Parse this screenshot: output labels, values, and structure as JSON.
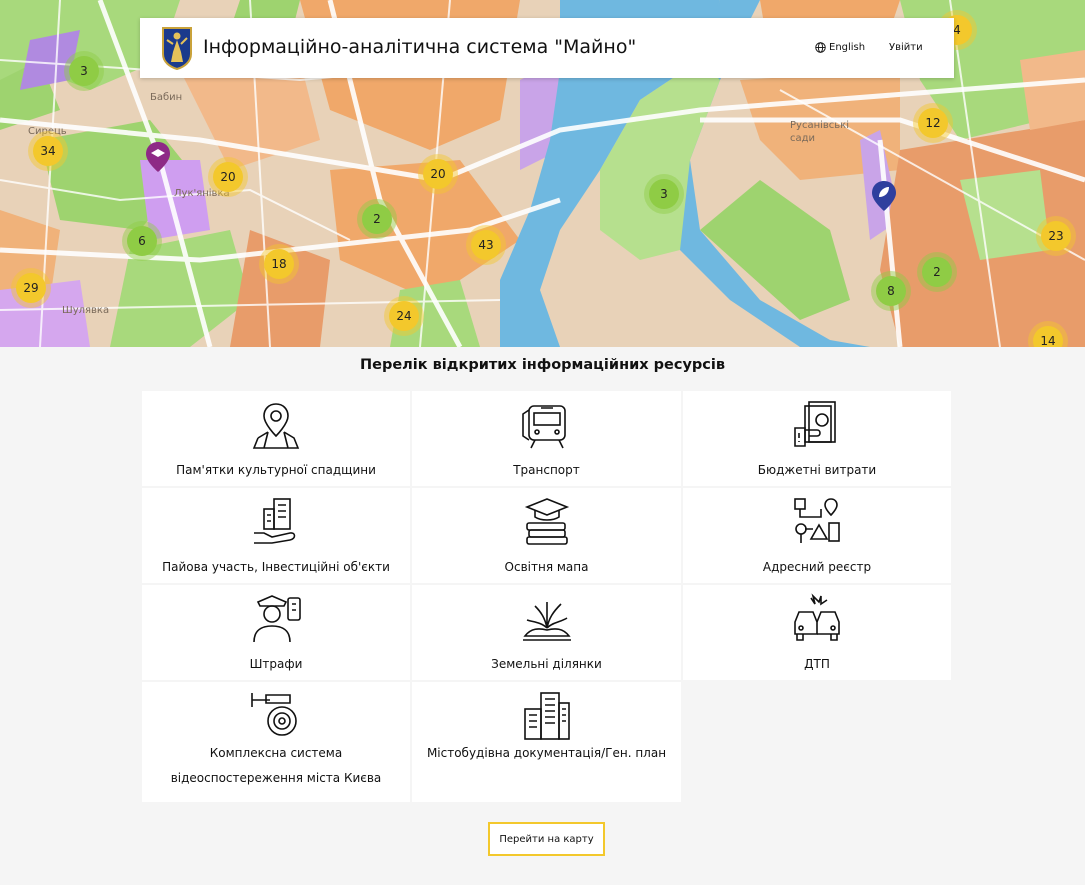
{
  "header": {
    "title": "Інформаційно-аналітична система \"Майно\"",
    "lang_label": "English",
    "login_label": "Увійти"
  },
  "map": {
    "clusters": [
      {
        "label": "3",
        "color": "green"
      },
      {
        "label": "34",
        "color": "yellow"
      },
      {
        "label": "20",
        "color": "yellow"
      },
      {
        "label": "20",
        "color": "yellow"
      },
      {
        "label": "2",
        "color": "green"
      },
      {
        "label": "43",
        "color": "yellow"
      },
      {
        "label": "6",
        "color": "green"
      },
      {
        "label": "18",
        "color": "yellow"
      },
      {
        "label": "29",
        "color": "yellow"
      },
      {
        "label": "24",
        "color": "yellow"
      },
      {
        "label": "3",
        "color": "green"
      },
      {
        "label": "12",
        "color": "yellow"
      },
      {
        "label": "23",
        "color": "yellow"
      },
      {
        "label": "2",
        "color": "green"
      },
      {
        "label": "8",
        "color": "green"
      },
      {
        "label": "14",
        "color": "yellow"
      },
      {
        "label": "4",
        "color": "yellow"
      }
    ],
    "place_labels": [
      "Бабин",
      "Сирець",
      "Лук'янівка",
      "Русанівські сади",
      "Шулявка"
    ]
  },
  "section_title": "Перелік відкритих інформаційних ресурсів",
  "resources": [
    {
      "label": "Пам'ятки культурної спадщини",
      "icon": "map-pin-icon"
    },
    {
      "label": "Транспорт",
      "icon": "metro-train-icon"
    },
    {
      "label": "Бюджетні витрати",
      "icon": "money-hand-icon"
    },
    {
      "label": "Пайова участь, Інвестиційні об'єкти",
      "icon": "building-hand-icon"
    },
    {
      "label": "Освітня мапа",
      "icon": "graduation-books-icon"
    },
    {
      "label": "Адресний реєстр",
      "icon": "address-route-icon"
    },
    {
      "label": "Штрафи",
      "icon": "police-officer-icon"
    },
    {
      "label": "Земельні ділянки",
      "icon": "land-plant-icon"
    },
    {
      "label": "ДТП",
      "icon": "car-crash-icon"
    },
    {
      "label": "Комплексна система відеоспостереження міста Києва",
      "icon": "cctv-camera-icon"
    },
    {
      "label": "Містобудівна документація/Ген. план",
      "icon": "city-buildings-icon"
    }
  ],
  "map_button_label": "Перейти на карту",
  "colors": {
    "accent": "#f3c82c",
    "cluster_green": "#8fcc45"
  }
}
